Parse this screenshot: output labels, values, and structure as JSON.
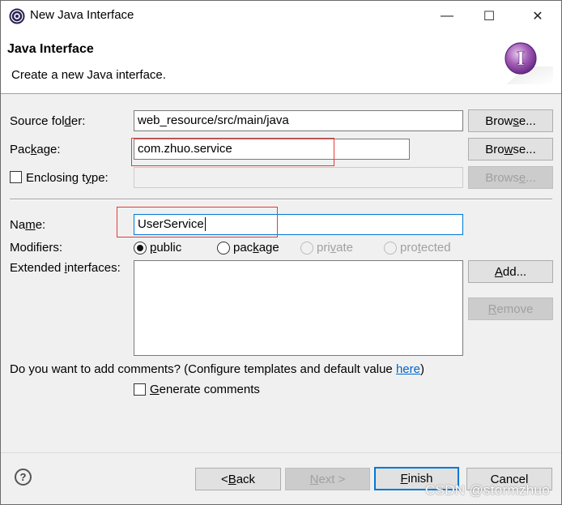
{
  "window": {
    "title": "New Java Interface",
    "minimize_glyph": "—",
    "maximize_glyph": "☐",
    "close_glyph": "✕"
  },
  "banner": {
    "title": "Java Interface",
    "description": "Create a new Java interface.",
    "icon_letter": "I"
  },
  "form": {
    "source_folder": {
      "label_pre": "Source fol",
      "label_u": "d",
      "label_post": "er:",
      "value": "web_resource/src/main/java",
      "browse_pre": "Brow",
      "browse_u": "s",
      "browse_post": "e..."
    },
    "package": {
      "label_pre": "Pac",
      "label_u": "k",
      "label_post": "age:",
      "value": "com.zhuo.service",
      "browse_pre": "Bro",
      "browse_u": "w",
      "browse_post": "se..."
    },
    "enclosing_type": {
      "label_pre": "Enclosing t",
      "label_u": "y",
      "label_post": "pe:",
      "value": "",
      "checked": false,
      "browse_pre": "Brows",
      "browse_u": "e",
      "browse_post": "..."
    },
    "name": {
      "label_pre": "Na",
      "label_u": "m",
      "label_post": "e:",
      "value": "UserService"
    },
    "modifiers": {
      "label": "Modifiers:",
      "options": [
        {
          "pre": "",
          "u": "p",
          "post": "ublic",
          "checked": true,
          "enabled": true
        },
        {
          "pre": "pac",
          "u": "k",
          "post": "age",
          "checked": false,
          "enabled": true
        },
        {
          "pre": "pri",
          "u": "v",
          "post": "ate",
          "checked": false,
          "enabled": false
        },
        {
          "pre": "pro",
          "u": "t",
          "post": "ected",
          "checked": false,
          "enabled": false
        }
      ]
    },
    "extended_interfaces": {
      "label_pre": "Extended ",
      "label_u": "i",
      "label_post": "nterfaces:",
      "items": []
    },
    "add_button": {
      "pre": "",
      "u": "A",
      "post": "dd..."
    },
    "remove_button": {
      "pre": "",
      "u": "R",
      "post": "emove"
    },
    "comments_question_pre": "Do you want to add comments? (Configure templates and default value ",
    "comments_question_link": "here",
    "comments_question_post": ")",
    "generate_comments": {
      "pre": "",
      "u": "G",
      "post": "enerate comments",
      "checked": false
    }
  },
  "footer": {
    "help_glyph": "?",
    "back": {
      "pre": "< ",
      "u": "B",
      "post": "ack"
    },
    "next": {
      "pre": "",
      "u": "N",
      "post": "ext >"
    },
    "finish": {
      "pre": "",
      "u": "F",
      "post": "inish"
    },
    "cancel": "Cancel"
  },
  "watermark": "CSDN @stormzhuo",
  "colors": {
    "accent": "#0078d7",
    "highlight_box": "#e43b3b",
    "link": "#0066cc"
  }
}
